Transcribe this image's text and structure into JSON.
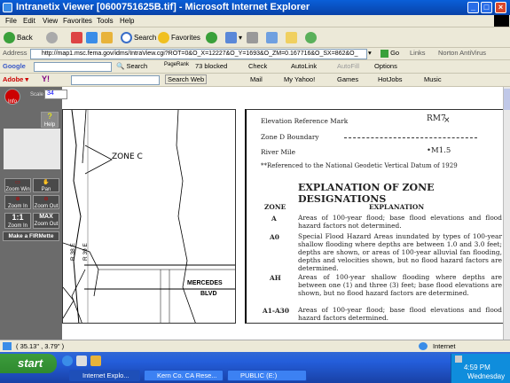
{
  "window": {
    "title": "Intranetix Viewer [0600751625B.tif] - Microsoft Internet Explorer"
  },
  "menu": [
    "File",
    "Edit",
    "View",
    "Favorites",
    "Tools",
    "Help"
  ],
  "toolbar": {
    "back": "Back",
    "search": "Search",
    "favorites": "Favorites"
  },
  "address": {
    "label": "Address",
    "url": "http://map1.msc.fema.gov/idms/IntraView.cgi?ROT=0&O_X=12227&O_Y=1693&O_ZM=0.167716&O_SX=862&O_",
    "go": "Go",
    "links": "Links",
    "norton": "Norton AntiVirus"
  },
  "google": {
    "label": "Google",
    "search": "Search",
    "pagerank": "PageRank",
    "blocked": "73 blocked",
    "check": "Check",
    "autolink": "AutoLink",
    "autofill": "AutoFill",
    "options": "Options"
  },
  "yahoo": {
    "label": "Y!",
    "search_web": "Search Web",
    "mail": "Mail",
    "myyahoo": "My Yahoo!",
    "games": "Games",
    "hotjobs": "HotJobs",
    "music": "Music"
  },
  "viewer": {
    "info": "Info",
    "scale_label": "Scale",
    "scale_value": "34",
    "help": "Help",
    "zoom_win": "Zoom Win",
    "pan": "Pan",
    "zoom_in": "Zoom In",
    "zoom_out": "Zoom Out",
    "one_to_one": "1:1",
    "zoom_in2": "Zoom In",
    "max": "MAX",
    "zoom_out2": "Zoom Out",
    "firmette": "Make a FIRMette"
  },
  "map": {
    "zone_label": "ZONE C",
    "road1": "R 38 E",
    "road2": "R 39 E",
    "street1": "MERCEDES",
    "street2": "BLVD"
  },
  "legend": {
    "elev_ref": "Elevation Reference Mark",
    "elev_ref_val": "RM7",
    "zone_d": "Zone D Boundary",
    "river_mile": "River Mile",
    "river_mile_val": "•M1.5",
    "datum": "**Referenced to the National Geodetic Vertical Datum of 1929",
    "heading": "EXPLANATION OF ZONE DESIGNATIONS",
    "col_zone": "ZONE",
    "col_expl": "EXPLANATION",
    "rows": [
      {
        "zone": "A",
        "text": "Areas of 100-year flood; base flood elevations and flood hazard factors not determined."
      },
      {
        "zone": "A0",
        "text": "Special Flood Hazard Areas inundated by types of 100-year shallow flooding where depths are between 1.0 and 3.0 feet; depths are shown, or areas of 100-year alluvial fan flooding, depths and velocities shown, but no flood hazard factors are determined."
      },
      {
        "zone": "AH",
        "text": "Areas of 100-year shallow flooding where depths are between one (1) and three (3) feet; base flood elevations are shown, but no flood hazard factors are determined."
      },
      {
        "zone": "A1-A30",
        "text": "Areas of 100-year flood; base flood elevations and flood hazard factors determined."
      }
    ]
  },
  "status": {
    "coords": "( 35.13\" , 3.79\" )",
    "zone": "Internet"
  },
  "taskbar": {
    "start": "start",
    "tasks": [
      "Internet Explo...",
      "Kern Co. CA Rese...",
      "PUBLIC (E:)"
    ],
    "time": "4:59 PM",
    "day": "Wednesday"
  }
}
